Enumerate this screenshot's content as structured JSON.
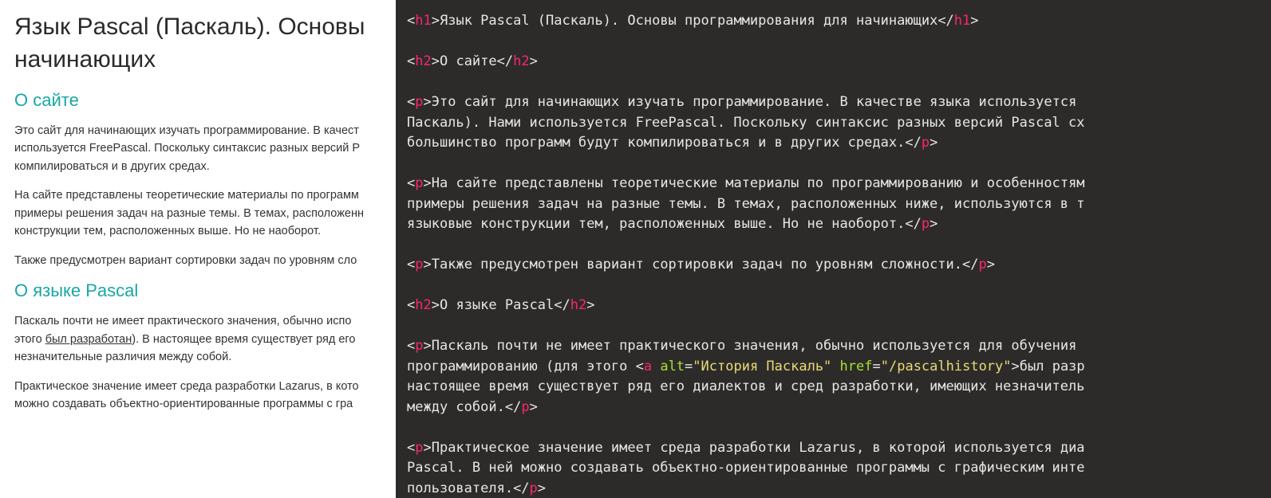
{
  "left": {
    "h1_l1": "Язык Pascal (Паскаль). Основы",
    "h1_l2": "начинающих",
    "h2a": "О сайте",
    "p1_l1": "Это сайт для начинающих изучать программирование. В качест",
    "p1_l2": "используется FreePascal. Поскольку синтаксис разных версий P",
    "p1_l3": "компилироваться и в других средах.",
    "p2_l1": "На сайте представлены теоретические материалы по программ",
    "p2_l2": "примеры решения задач на разные темы. В темах, расположенн",
    "p2_l3": "конструкции тем, расположенных выше. Но не наоборот.",
    "p3_l1": "Также предусмотрен вариант сортировки задач по уровням сло",
    "h2b": "О языке Pascal",
    "p4_pre": "Паскаль почти не имеет практического значения, обычно испо",
    "p4_l2a": "этого ",
    "p4_link": "был разработан",
    "p4_l2b": "). В настоящее время существует ряд его ",
    "p4_l3": "незначительные различия между собой.",
    "p5_l1": "Практическое значение имеет среда разработки Lazarus, в кото",
    "p5_l2": "можно создавать объектно-ориентированные программы с гра"
  },
  "code": {
    "h1_open": "h1",
    "h1_text": "Язык Pascal (Паскаль). Основы программирования для начинающих",
    "h2a_text": "О сайте",
    "p1_a": "Это сайт для начинающих изучать программирование. В качестве языка используется",
    "p1_b": "Паскаль). Нами используется FreePascal. Поскольку синтаксис разных версий Pascal сх",
    "p1_c": "большинство программ будут компилироваться и в других средах.",
    "p2_a": "На сайте представлены теоретические материалы по программированию и особенностям",
    "p2_b": "примеры решения задач на разные темы. В темах, расположенных ниже, используются в т",
    "p2_c": "языковые конструкции тем, расположенных выше. Но не наоборот.",
    "p3": "Также предусмотрен вариант сортировки задач по уровням сложности.",
    "h2b_text": "О языке Pascal",
    "p4_a": "Паскаль почти не имеет практического значения, обычно используется для обучения",
    "p4_b_pre": "программированию (для этого ",
    "p4_alt": "alt",
    "p4_alt_val": "\"История Паскаль\"",
    "p4_href": "href",
    "p4_href_val": "\"/pascalhistory\"",
    "p4_b_post": "был разр",
    "p4_c": "настоящее время существует ряд его диалектов и сред разработки, имеющих незначитель",
    "p4_d": "между собой.",
    "p5_a": "Практическое значение имеет среда разработки Lazarus, в которой используется диа",
    "p5_b": "Pascal. В ней можно создавать объектно-ориентированные программы с графическим инте",
    "p5_c": "пользователя."
  }
}
